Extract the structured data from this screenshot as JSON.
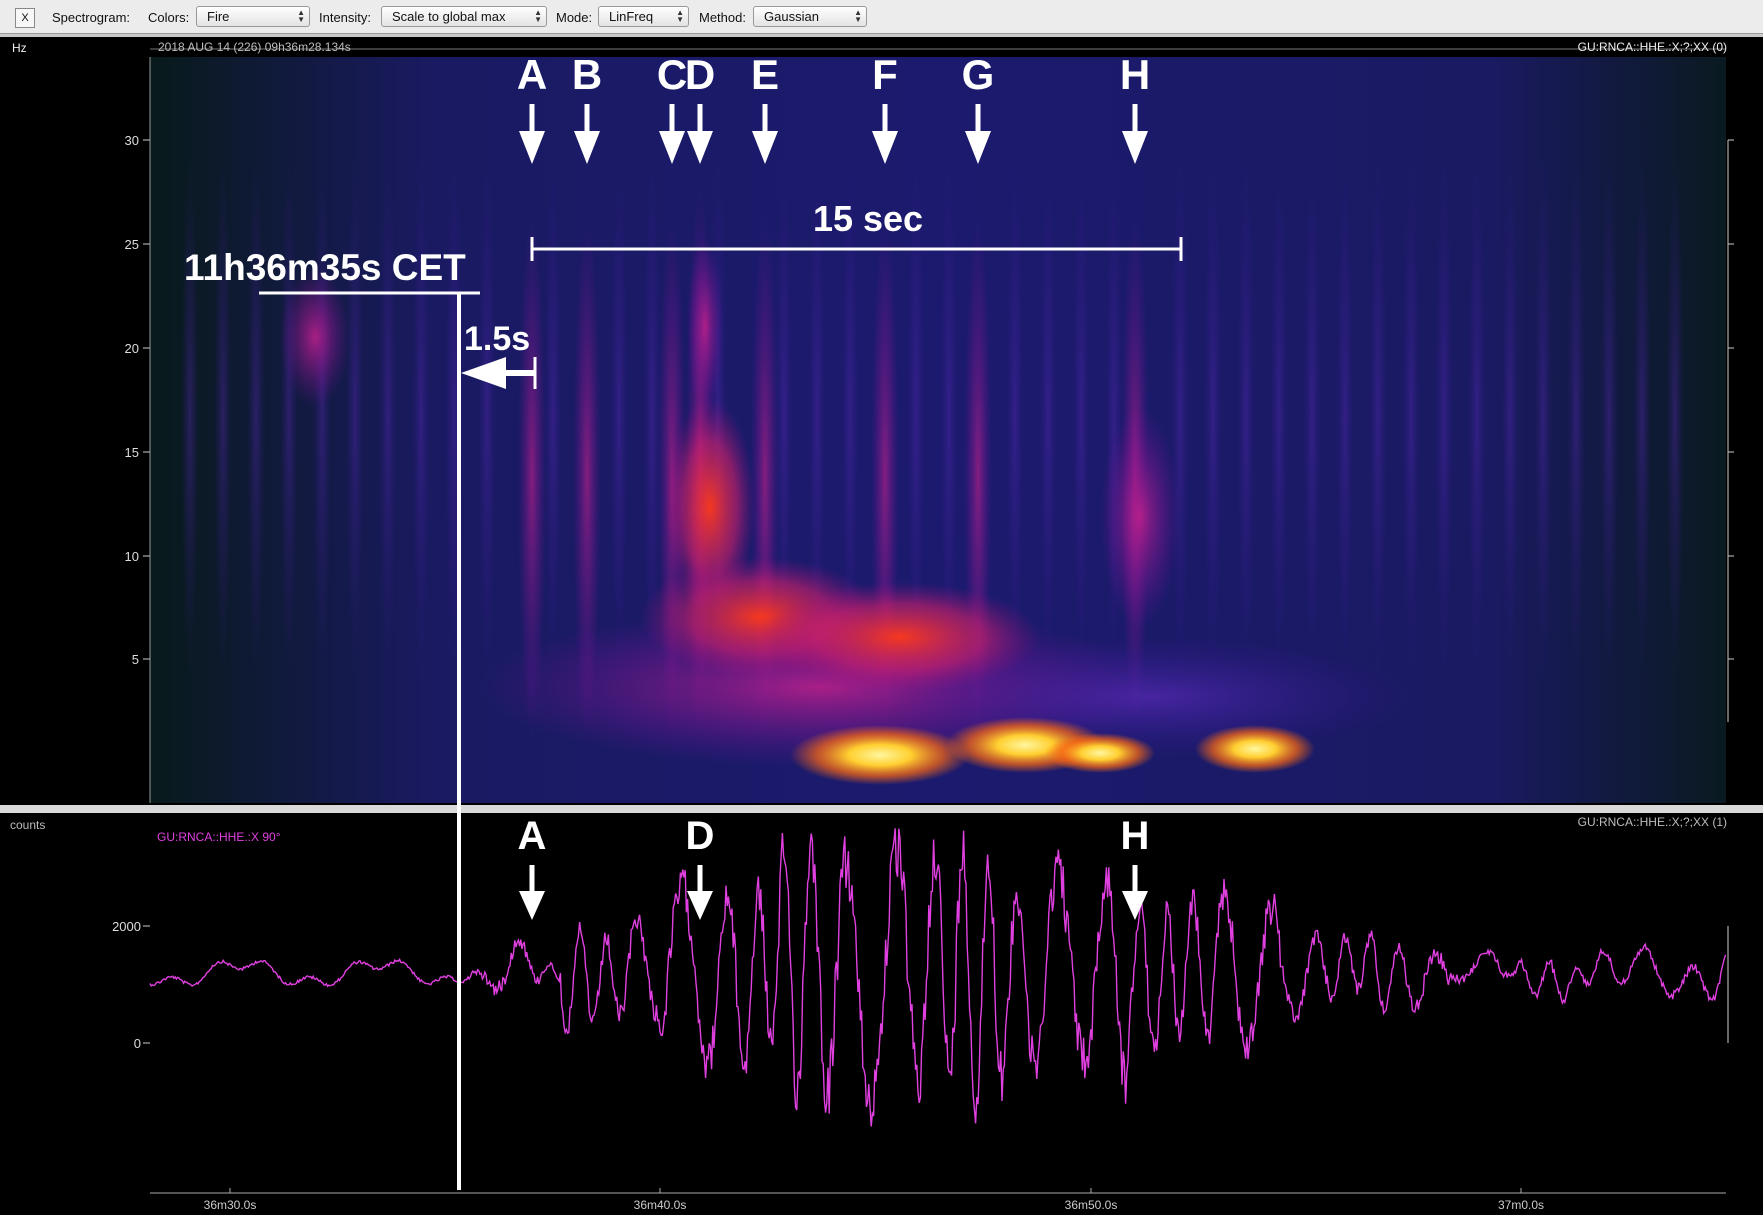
{
  "toolbar": {
    "close_label": "X",
    "spectrogram_label": "Spectrogram:",
    "colors_label": "Colors:",
    "colors_value": "Fire",
    "intensity_label": "Intensity:",
    "intensity_value": "Scale to global max",
    "mode_label": "Mode:",
    "mode_value": "LinFreq",
    "method_label": "Method:",
    "method_value": "Gaussian"
  },
  "spectrogram": {
    "unit": "Hz",
    "start_time": "2018 AUG 14 (226)  09h36m28.134s",
    "channel_label": "GU:RNCA::HHE.:X;?;XX (0)",
    "y_ticks": [
      "30",
      "25",
      "20",
      "15",
      "10",
      "5"
    ],
    "peaks": [
      "A",
      "B",
      "C",
      "D",
      "E",
      "F",
      "G",
      "H"
    ],
    "duration_label": "15 sec",
    "time_label": "11h36m35s CET",
    "offset_label": "1.5s"
  },
  "waveform": {
    "unit": "counts",
    "trace_label": "GU:RNCA::HHE.:X 90°",
    "channel_label": "GU:RNCA::HHE.:X;?;XX (1)",
    "y_ticks": [
      "2000",
      "0"
    ],
    "peaks": [
      "A",
      "D",
      "H"
    ],
    "x_ticks": [
      "36m30.0s",
      "36m40.0s",
      "36m50.0s",
      "37m0.0s"
    ]
  },
  "colors": {
    "trace": "#e040e0",
    "spectrogram_bg": "#10104a",
    "spectrogram_hot": "#ffd23a"
  }
}
